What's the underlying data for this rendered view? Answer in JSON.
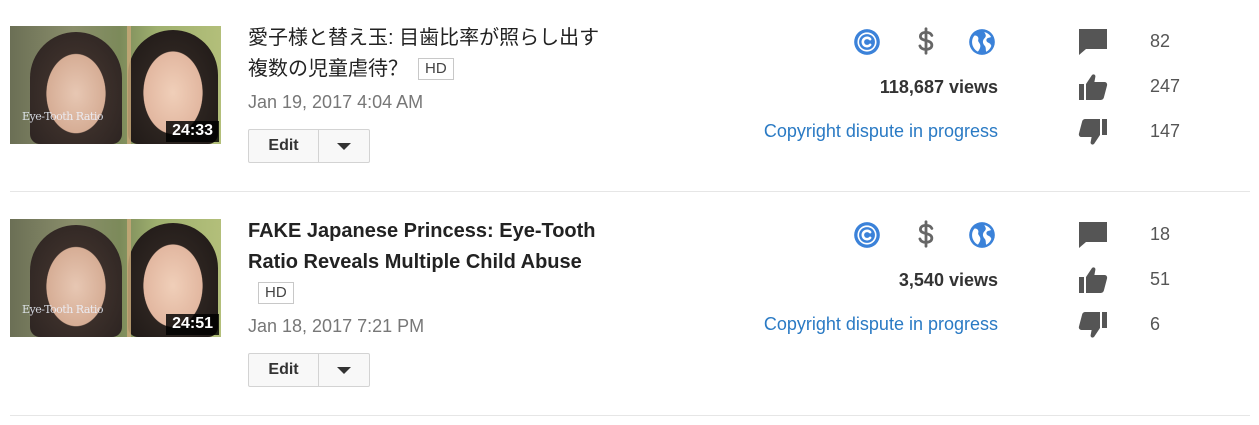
{
  "videos": [
    {
      "title": "愛子様と替え玉: 目歯比率が照らし出す複数の児童虐待？",
      "hd_badge": "HD",
      "date": "Jan 19, 2017 4:04 AM",
      "duration": "24:33",
      "thumbnail_caption": "Eye-Tooth Ratio",
      "views": "118,687 views",
      "dispute": "Copyright dispute in progress",
      "comments": "82",
      "likes": "247",
      "dislikes": "147",
      "edit_label": "Edit"
    },
    {
      "title": "FAKE Japanese Princess: Eye-Tooth Ratio Reveals Multiple Child Abuse",
      "hd_badge": "HD",
      "date": "Jan 18, 2017 7:21 PM",
      "duration": "24:51",
      "thumbnail_caption": "Eye-Tooth Ratio",
      "views": "3,540 views",
      "dispute": "Copyright dispute in progress",
      "comments": "18",
      "likes": "51",
      "dislikes": "6",
      "edit_label": "Edit"
    }
  ],
  "icons": {
    "copyright": "copyright-icon",
    "monetization": "dollar-icon",
    "visibility": "globe-icon",
    "comments": "comment-icon",
    "likes": "thumbs-up-icon",
    "dislikes": "thumbs-down-icon",
    "dropdown": "caret-down-icon"
  },
  "colors": {
    "status_icon": "#3b82d9",
    "money_icon": "#666666",
    "link": "#2a7ac4",
    "stat_icon": "#555555"
  }
}
